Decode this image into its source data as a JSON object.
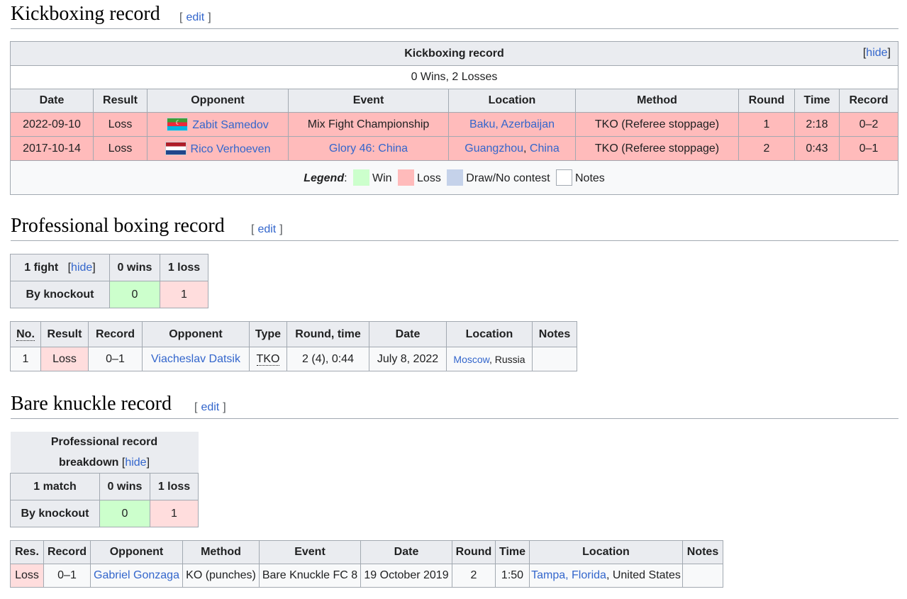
{
  "kickboxing": {
    "heading": "Kickboxing record",
    "edit": "edit",
    "table_title": "Kickboxing record",
    "hide": "hide",
    "summary": "0 Wins, 2 Losses",
    "columns": [
      "Date",
      "Result",
      "Opponent",
      "Event",
      "Location",
      "Method",
      "Round",
      "Time",
      "Record"
    ],
    "rows": [
      {
        "date": "2022-09-10",
        "result": "Loss",
        "flag": "azerbaijan-flag-icon",
        "opponent": "Zabit Samedov",
        "event": "Mix Fight Championship",
        "location_city": "Baku, Azerbaijan",
        "location_sep": "",
        "location_country": "",
        "method": "TKO (Referee stoppage)",
        "round": "1",
        "time": "2:18",
        "record": "0–2"
      },
      {
        "date": "2017-10-14",
        "result": "Loss",
        "flag": "netherlands-flag-icon",
        "opponent": "Rico Verhoeven",
        "event": "Glory 46: China",
        "location_city": "Guangzhou",
        "location_sep": ", ",
        "location_country": "China",
        "method": "TKO (Referee stoppage)",
        "round": "2",
        "time": "0:43",
        "record": "0–1"
      }
    ],
    "legend_label": "Legend",
    "legend_colon": ":",
    "legend": [
      {
        "label": "Win",
        "color": "#ccffcc"
      },
      {
        "label": "Loss",
        "color": "#ffbbbb"
      },
      {
        "label": "Draw/No contest",
        "color": "#c5d2ea"
      },
      {
        "label": "Notes",
        "color": "#ffffff"
      }
    ]
  },
  "boxing": {
    "heading": "Professional boxing record",
    "edit": "edit",
    "summary": {
      "fights": "1 fight",
      "hide": "hide",
      "wins": "0 wins",
      "losses": "1 loss",
      "method": "By knockout",
      "ko_wins": "0",
      "ko_losses": "1"
    },
    "columns": [
      "No.",
      "Result",
      "Record",
      "Opponent",
      "Type",
      "Round, time",
      "Date",
      "Location",
      "Notes"
    ],
    "rows": [
      {
        "no": "1",
        "result": "Loss",
        "record": "0–1",
        "opponent": "Viacheslav Datsik",
        "type": "TKO",
        "round_time": "2 (4), 0:44",
        "date": "July 8, 2022",
        "location_city": "Moscow",
        "location_rest": ", Russia",
        "notes": ""
      }
    ]
  },
  "bare_knuckle": {
    "heading": "Bare knuckle record",
    "edit": "edit",
    "summary": {
      "title_line1": "Professional record",
      "title_line2": "breakdown",
      "hide": "hide",
      "matches": "1 match",
      "wins": "0 wins",
      "losses": "1 loss",
      "method": "By knockout",
      "ko_wins": "0",
      "ko_losses": "1"
    },
    "columns": [
      "Res.",
      "Record",
      "Opponent",
      "Method",
      "Event",
      "Date",
      "Round",
      "Time",
      "Location",
      "Notes"
    ],
    "rows": [
      {
        "res": "Loss",
        "record": "0–1",
        "opponent": "Gabriel Gonzaga",
        "method": "KO (punches)",
        "event": "Bare Knuckle FC 8",
        "date": "19 October 2019",
        "round": "2",
        "time": "1:50",
        "location_city": "Tampa, Florida",
        "location_rest": ", United States",
        "notes": ""
      }
    ]
  }
}
